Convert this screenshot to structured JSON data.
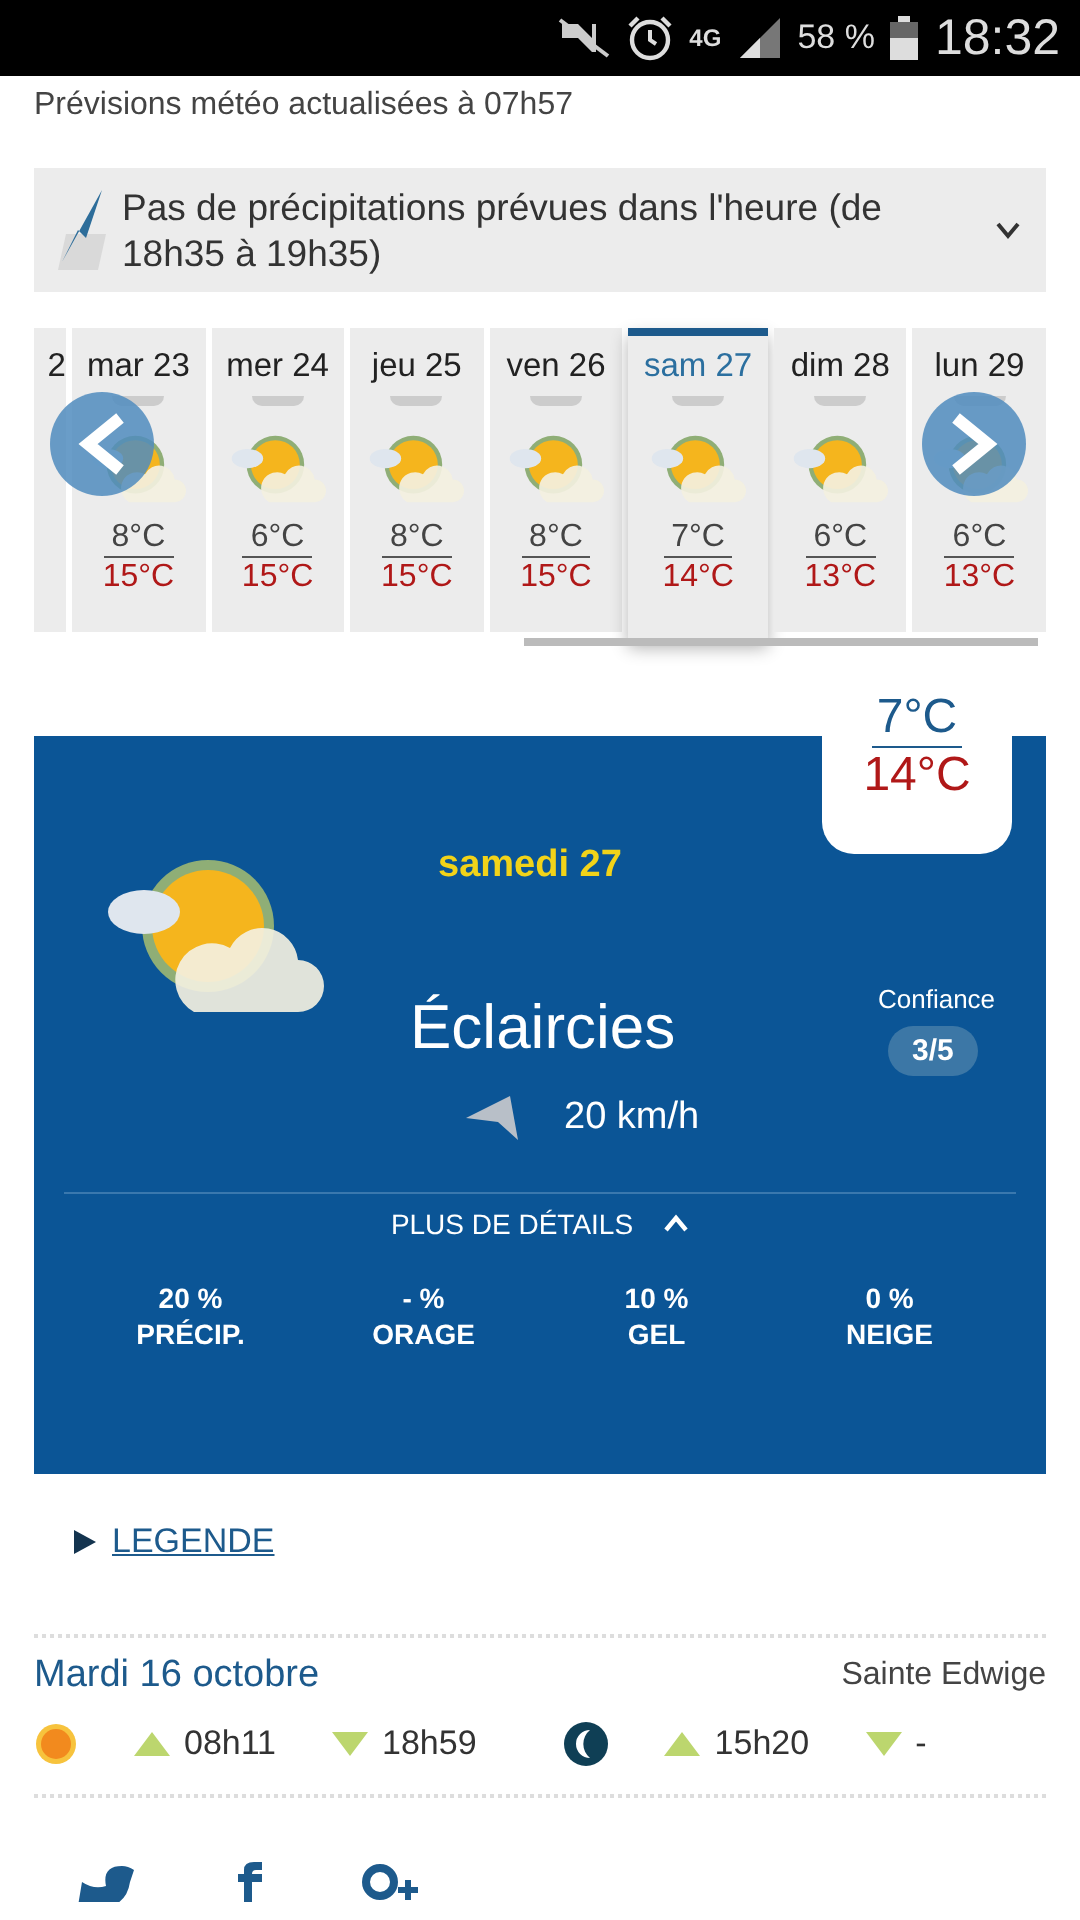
{
  "status_bar": {
    "network": "4G",
    "battery": "58 %",
    "time": "18:32"
  },
  "updated": "Prévisions météo actualisées à 07h57",
  "rain_banner": {
    "text": "Pas de précipitations prévues dans l'heure (de 18h35 à 19h35)",
    "expanded": false
  },
  "days": [
    {
      "kind": "partial",
      "label": "2"
    },
    {
      "kind": "day",
      "label": "mar 23",
      "low": "8°C",
      "high": "15°C",
      "selected": false
    },
    {
      "kind": "day",
      "label": "mer 24",
      "low": "6°C",
      "high": "15°C",
      "selected": false
    },
    {
      "kind": "day",
      "label": "jeu 25",
      "low": "8°C",
      "high": "15°C",
      "selected": false
    },
    {
      "kind": "day",
      "label": "ven 26",
      "low": "8°C",
      "high": "15°C",
      "selected": false
    },
    {
      "kind": "day",
      "label": "sam 27",
      "low": "7°C",
      "high": "14°C",
      "selected": true
    },
    {
      "kind": "day",
      "label": "dim 28",
      "low": "6°C",
      "high": "13°C",
      "selected": false
    },
    {
      "kind": "day",
      "label": "lun 29",
      "low": "6°C",
      "high": "13°C",
      "selected": false
    }
  ],
  "detail": {
    "low": "7°C",
    "high": "14°C",
    "date": "samedi 27",
    "condition": "Éclaircies",
    "confidence_label": "Confiance",
    "confidence": "3/5",
    "wind": "20 km/h",
    "details_toggle": {
      "label": "PLUS DE DÉTAILS",
      "expanded": true
    },
    "stats": [
      {
        "value": "20 %",
        "label": "PRÉCIP."
      },
      {
        "value": "- %",
        "label": "ORAGE"
      },
      {
        "value": "10 %",
        "label": "GEL"
      },
      {
        "value": "0 %",
        "label": "NEIGE"
      }
    ]
  },
  "legend_link": "LEGENDE",
  "ephemeris": {
    "date": "Mardi 16 octobre",
    "saint": "Sainte Edwige",
    "sunrise": "08h11",
    "sunset": "18h59",
    "moonrise": "15h20",
    "moonset": "-"
  }
}
